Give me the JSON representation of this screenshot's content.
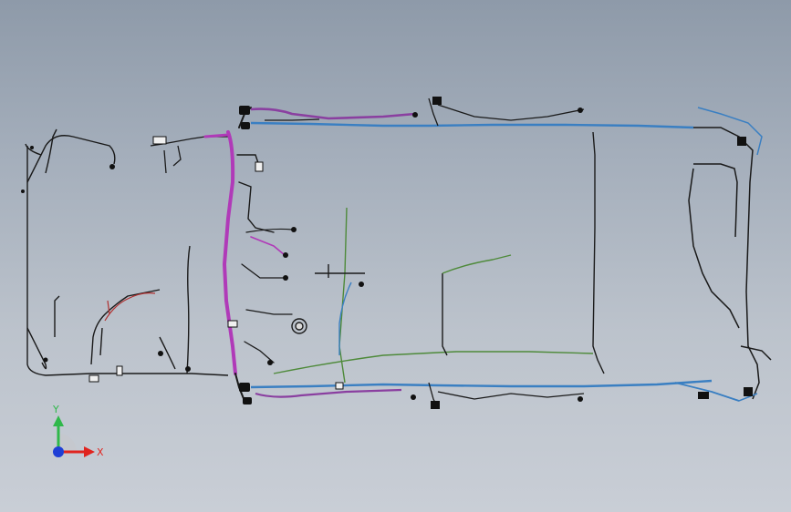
{
  "view": {
    "background_top": "#8e9aa9",
    "background_bottom": "#c9ced6"
  },
  "harness": {
    "colors": {
      "main": "#1a1a1a",
      "magenta": "#b03ab8",
      "purple": "#8a3fa0",
      "blue": "#3a7fc2",
      "green": "#4e8a3a",
      "red": "#b03030",
      "connector": "#111111"
    }
  },
  "triad": {
    "y_label": "Y",
    "x_label": "X",
    "y_color": "#2fb84a",
    "x_color": "#e0241f",
    "origin_color": "#1f3fd6"
  }
}
